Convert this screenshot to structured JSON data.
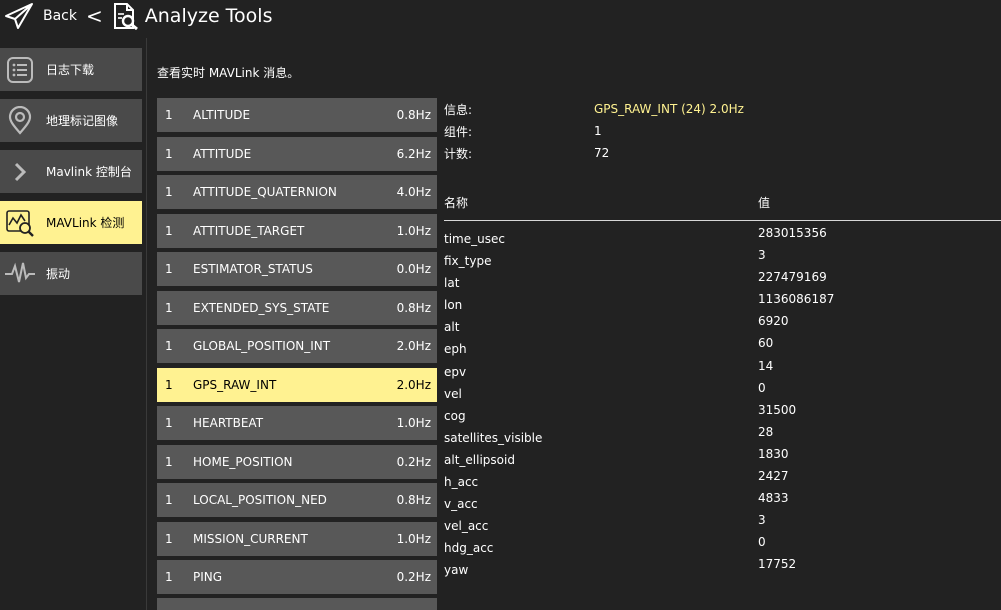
{
  "header": {
    "back_label": "Back",
    "separator": "<",
    "title": "Analyze Tools"
  },
  "sidebar": {
    "items": [
      {
        "label": "日志下载",
        "icon": "list-icon"
      },
      {
        "label": "地理标记图像",
        "icon": "map-pin-icon"
      },
      {
        "label": "Mavlink 控制台",
        "icon": "chevron-right-icon"
      },
      {
        "label": "MAVLink 检测",
        "icon": "chart-inspect-icon",
        "active": true
      },
      {
        "label": "振动",
        "icon": "waveform-icon"
      }
    ]
  },
  "main": {
    "caption": "查看实时 MAVLink 消息。"
  },
  "messages": [
    {
      "comp": "1",
      "name": "ALTITUDE",
      "hz": "0.8Hz"
    },
    {
      "comp": "1",
      "name": "ATTITUDE",
      "hz": "6.2Hz"
    },
    {
      "comp": "1",
      "name": "ATTITUDE_QUATERNION",
      "hz": "4.0Hz"
    },
    {
      "comp": "1",
      "name": "ATTITUDE_TARGET",
      "hz": "1.0Hz"
    },
    {
      "comp": "1",
      "name": "ESTIMATOR_STATUS",
      "hz": "0.0Hz"
    },
    {
      "comp": "1",
      "name": "EXTENDED_SYS_STATE",
      "hz": "0.8Hz"
    },
    {
      "comp": "1",
      "name": "GLOBAL_POSITION_INT",
      "hz": "2.0Hz"
    },
    {
      "comp": "1",
      "name": "GPS_RAW_INT",
      "hz": "2.0Hz",
      "selected": true
    },
    {
      "comp": "1",
      "name": "HEARTBEAT",
      "hz": "1.0Hz"
    },
    {
      "comp": "1",
      "name": "HOME_POSITION",
      "hz": "0.2Hz"
    },
    {
      "comp": "1",
      "name": "LOCAL_POSITION_NED",
      "hz": "0.8Hz"
    },
    {
      "comp": "1",
      "name": "MISSION_CURRENT",
      "hz": "1.0Hz"
    },
    {
      "comp": "1",
      "name": "PING",
      "hz": "0.2Hz"
    }
  ],
  "info": {
    "message_label": "信息:",
    "message_value": "GPS_RAW_INT (24) 2.0Hz",
    "component_label": "组件:",
    "component_value": "1",
    "count_label": "计数:",
    "count_value": "72"
  },
  "fields_header": {
    "name": "名称",
    "value": "值"
  },
  "fields": [
    {
      "name": "time_usec",
      "value": "283015356"
    },
    {
      "name": "fix_type",
      "value": "3"
    },
    {
      "name": "lat",
      "value": "227479169"
    },
    {
      "name": "lon",
      "value": "1136086187"
    },
    {
      "name": "alt",
      "value": "6920"
    },
    {
      "name": "eph",
      "value": "60"
    },
    {
      "name": "epv",
      "value": "14"
    },
    {
      "name": "vel",
      "value": "0"
    },
    {
      "name": "cog",
      "value": "31500"
    },
    {
      "name": "satellites_visible",
      "value": "28"
    },
    {
      "name": "alt_ellipsoid",
      "value": "1830"
    },
    {
      "name": "h_acc",
      "value": "2427"
    },
    {
      "name": "v_acc",
      "value": "4833"
    },
    {
      "name": "vel_acc",
      "value": "3"
    },
    {
      "name": "hdg_acc",
      "value": "0"
    },
    {
      "name": "yaw",
      "value": "17752"
    }
  ],
  "colors": {
    "background": "#222222",
    "panel": "#4a4a4a",
    "row": "#585858",
    "highlight": "#fff291",
    "text": "#ffffff"
  }
}
